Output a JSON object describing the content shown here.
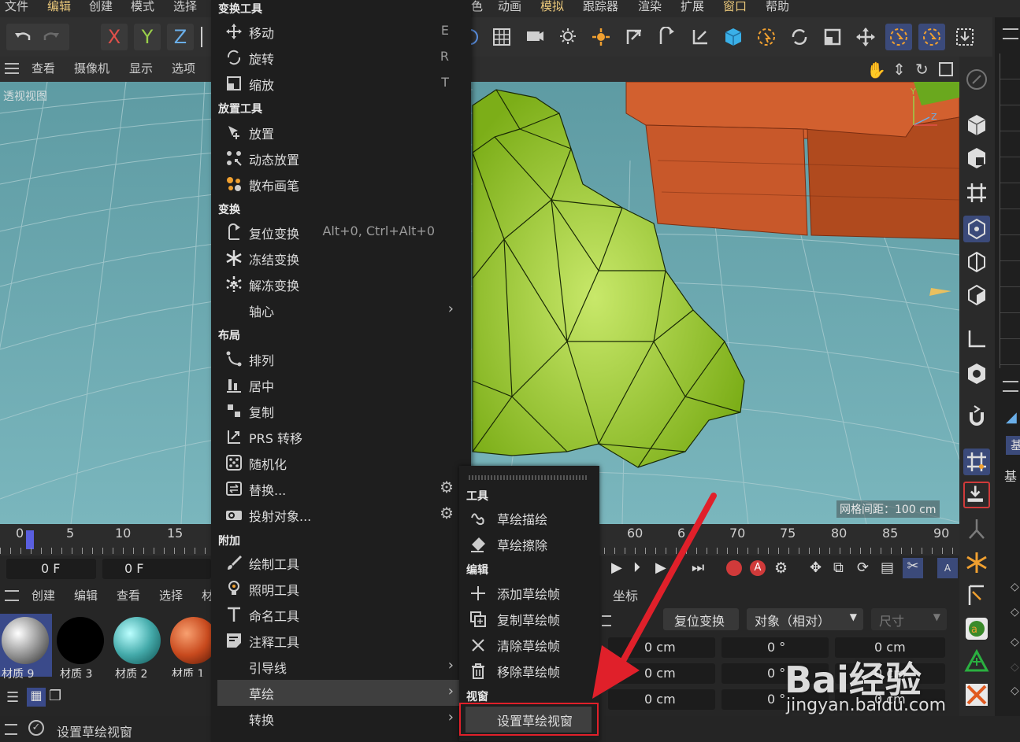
{
  "menubar": {
    "items": [
      "文件",
      "编辑",
      "创建",
      "模式",
      "选择",
      "色",
      "动画",
      "模拟",
      "跟踪器",
      "渲染",
      "扩展",
      "窗口",
      "帮助"
    ]
  },
  "toolbar": {
    "undo": "undo-icon",
    "redo": "redo-icon",
    "x": "X",
    "y": "Y",
    "z": "Z"
  },
  "viewport": {
    "menu": [
      "查看",
      "摄像机",
      "显示",
      "选项"
    ],
    "label": "透视视图",
    "grid_spacing": "网格间距：100 cm"
  },
  "timeline": {
    "ticks_left": [
      "0",
      "5",
      "10",
      "15"
    ],
    "ticks_right": [
      "60",
      "6",
      "70",
      "75",
      "80",
      "85",
      "90"
    ],
    "frame_a": "0 F",
    "frame_b": "0 F"
  },
  "materials": {
    "menu": [
      "创建",
      "编辑",
      "查看",
      "选择",
      "材"
    ],
    "items": [
      "材质 9",
      "材质 3",
      "材质 2",
      "材质 1"
    ]
  },
  "status": {
    "text": "设置草绘视窗"
  },
  "coords": {
    "tab": "坐标",
    "reset_btn": "复位变换",
    "mode": "对象（相对）",
    "size": "尺寸",
    "rows": [
      [
        "0 cm",
        "0 °",
        "0 cm"
      ],
      [
        "0 cm",
        "0 °",
        "0 cm"
      ],
      [
        "0 cm",
        "0 °",
        "0 cm"
      ]
    ]
  },
  "farright": {
    "tab": "基",
    "label": "基"
  },
  "menu": {
    "sections": {
      "transform_tools": "变换工具",
      "place_tools": "放置工具",
      "transform": "变换",
      "layout": "布局",
      "extra": "附加"
    },
    "items": {
      "move": {
        "label": "移动",
        "shortcut": "E"
      },
      "rotate": {
        "label": "旋转",
        "shortcut": "R"
      },
      "scale": {
        "label": "缩放",
        "shortcut": "T"
      },
      "place": {
        "label": "放置"
      },
      "dynamic_place": {
        "label": "动态放置"
      },
      "scatter_brush": {
        "label": "散布画笔"
      },
      "reset_transform": {
        "label": "复位变换",
        "shortcut": "Alt+0, Ctrl+Alt+0"
      },
      "freeze_transform": {
        "label": "冻结变换"
      },
      "unfreeze_transform": {
        "label": "解冻变换"
      },
      "pivot": {
        "label": "轴心"
      },
      "arrange": {
        "label": "排列"
      },
      "center": {
        "label": "居中"
      },
      "duplicate": {
        "label": "复制"
      },
      "prs_transfer": {
        "label": "PRS 转移"
      },
      "randomize": {
        "label": "随机化"
      },
      "replace": {
        "label": "替换..."
      },
      "project_object": {
        "label": "投射对象..."
      },
      "paint_tool": {
        "label": "绘制工具"
      },
      "lighting_tool": {
        "label": "照明工具"
      },
      "naming_tool": {
        "label": "命名工具"
      },
      "annotation_tool": {
        "label": "注释工具"
      },
      "guide": {
        "label": "引导线"
      },
      "sketch": {
        "label": "草绘"
      },
      "convert": {
        "label": "转换"
      }
    }
  },
  "submenu": {
    "sections": {
      "tools": "工具",
      "edit": "编辑",
      "viewport": "视窗"
    },
    "items": {
      "sketch_draw": "草绘描绘",
      "sketch_erase": "草绘擦除",
      "add_frame": "添加草绘帧",
      "copy_frame": "复制草绘帧",
      "clear_frame": "清除草绘帧",
      "remove_frame": "移除草绘帧",
      "set_viewport": "设置草绘视窗"
    }
  },
  "watermark": {
    "brand": "Bai经验",
    "url": "jingyan.baidu.com"
  },
  "colors": {
    "accent_red": "#e0202a",
    "menu_bg": "#1e1e1e",
    "ground": "#6aa6ae",
    "gem": "#9ccc2a",
    "brick": "#c8582a"
  }
}
